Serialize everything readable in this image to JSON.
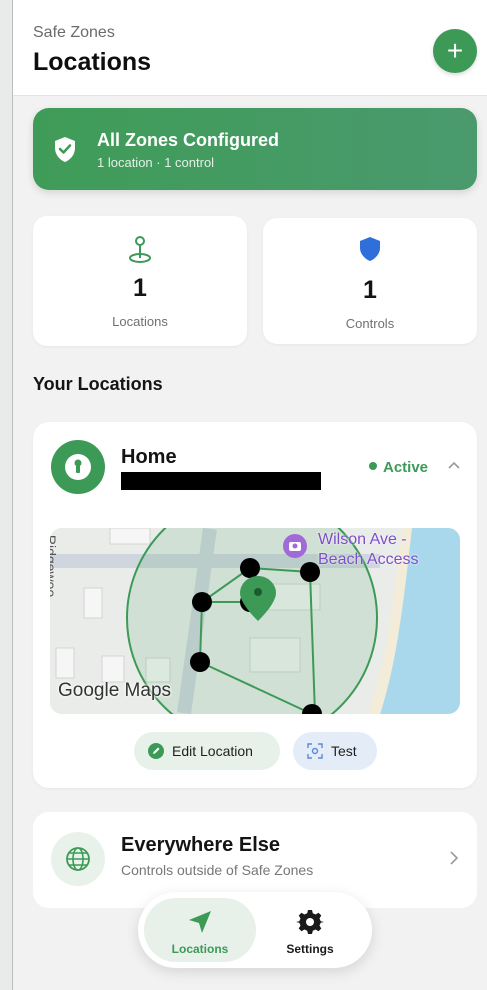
{
  "header": {
    "subtitle": "Safe Zones",
    "title": "Locations",
    "add_button": "+"
  },
  "banner": {
    "title": "All Zones Configured",
    "subtitle": "1 location · 1 control",
    "icon": "shield-check-icon",
    "color": "#3f9c57"
  },
  "stats": [
    {
      "icon": "map-pin-icon",
      "value": "1",
      "label": "Locations"
    },
    {
      "icon": "shield-icon",
      "value": "1",
      "label": "Controls"
    }
  ],
  "section_title": "Your Locations",
  "home": {
    "name": "Home",
    "status": "Active",
    "map": {
      "poi_line1": "Wilson Ave -",
      "poi_line2": "Beach Access",
      "street_label": "Ridgewoo",
      "attribution": "Google Maps"
    },
    "edit_label": "Edit Location",
    "test_label": "Test"
  },
  "everywhere": {
    "title": "Everywhere Else",
    "subtitle": "Controls outside of Safe Zones"
  },
  "nav": {
    "locations": "Locations",
    "settings": "Settings"
  },
  "colors": {
    "accent": "#3d9a56",
    "shield_blue": "#2f6fdc",
    "poi_purple": "#7d4fc8"
  }
}
